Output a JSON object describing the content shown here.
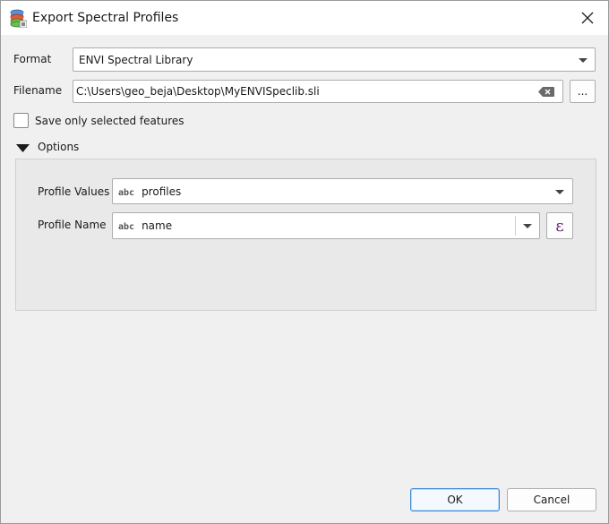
{
  "window": {
    "title": "Export Spectral Profiles",
    "close_glyph": "✕"
  },
  "form": {
    "format_label": "Format",
    "format_value": "ENVI Spectral Library",
    "filename_label": "Filename",
    "filename_value": "C:\\Users\\geo_beja\\Desktop\\MyENVISpeclib.sli",
    "browse_label": "...",
    "selected_only_label": "Save only selected features",
    "selected_only_checked": false
  },
  "options": {
    "header_label": "Options",
    "expanded": true,
    "profile_values_label": "Profile Values",
    "profile_values_type": "abc",
    "profile_values_value": "profiles",
    "profile_name_label": "Profile Name",
    "profile_name_type": "abc",
    "profile_name_value": "name",
    "expression_glyph": "ε"
  },
  "buttons": {
    "ok_label": "OK",
    "cancel_label": "Cancel"
  },
  "icons": {
    "app": "database-export-icon",
    "clear": "clear-text-icon",
    "expression": "expression-epsilon-icon"
  },
  "colors": {
    "accent": "#3c8ad8",
    "background": "#f0f0f0",
    "titlebar": "#ffffff"
  }
}
